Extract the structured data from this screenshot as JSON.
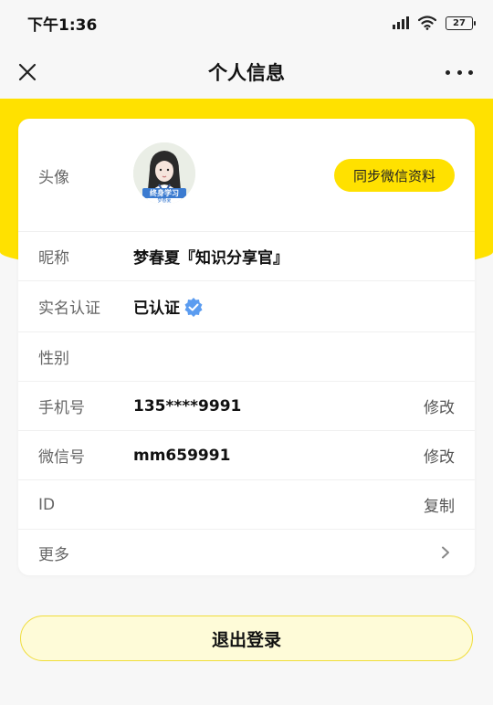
{
  "status_bar": {
    "time": "下午1:36",
    "battery": "27",
    "icons": [
      "signal-icon",
      "wifi-icon",
      "battery-icon"
    ]
  },
  "nav": {
    "title": "个人信息",
    "close_icon": "close-icon",
    "more_icon": "more-icon"
  },
  "profile": {
    "avatar": {
      "label": "头像",
      "badge_text": "终身学习",
      "badge_subtext": "梦春夏",
      "sync_button": "同步微信资料"
    },
    "nickname": {
      "label": "昵称",
      "value": "梦春夏『知识分享官』"
    },
    "real_name": {
      "label": "实名认证",
      "value": "已认证",
      "verified_icon": "verified-badge-icon"
    },
    "gender": {
      "label": "性别",
      "value": ""
    },
    "phone": {
      "label": "手机号",
      "value": "135****9991",
      "action": "修改"
    },
    "wechat": {
      "label": "微信号",
      "value": "mm659991",
      "action": "修改"
    },
    "id": {
      "label": "ID",
      "value": "",
      "action": "复制"
    },
    "more": {
      "label": "更多",
      "icon": "chevron-right-icon"
    }
  },
  "logout_button": "退出登录",
  "colors": {
    "accent_yellow": "#ffe100",
    "logout_bg": "#fefbd8",
    "verified_blue": "#5b9cf0"
  }
}
